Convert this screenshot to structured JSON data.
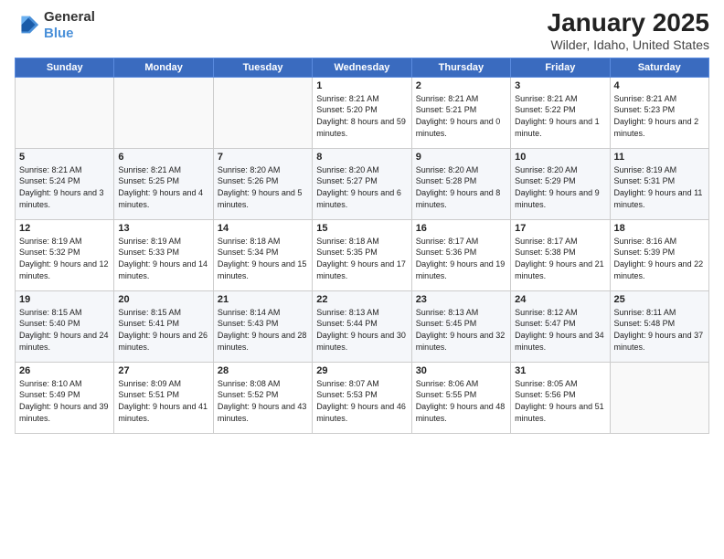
{
  "logo": {
    "general": "General",
    "blue": "Blue"
  },
  "title": "January 2025",
  "location": "Wilder, Idaho, United States",
  "weekdays": [
    "Sunday",
    "Monday",
    "Tuesday",
    "Wednesday",
    "Thursday",
    "Friday",
    "Saturday"
  ],
  "weeks": [
    [
      {
        "day": "",
        "sunrise": "",
        "sunset": "",
        "daylight": ""
      },
      {
        "day": "",
        "sunrise": "",
        "sunset": "",
        "daylight": ""
      },
      {
        "day": "",
        "sunrise": "",
        "sunset": "",
        "daylight": ""
      },
      {
        "day": "1",
        "sunrise": "Sunrise: 8:21 AM",
        "sunset": "Sunset: 5:20 PM",
        "daylight": "Daylight: 8 hours and 59 minutes."
      },
      {
        "day": "2",
        "sunrise": "Sunrise: 8:21 AM",
        "sunset": "Sunset: 5:21 PM",
        "daylight": "Daylight: 9 hours and 0 minutes."
      },
      {
        "day": "3",
        "sunrise": "Sunrise: 8:21 AM",
        "sunset": "Sunset: 5:22 PM",
        "daylight": "Daylight: 9 hours and 1 minute."
      },
      {
        "day": "4",
        "sunrise": "Sunrise: 8:21 AM",
        "sunset": "Sunset: 5:23 PM",
        "daylight": "Daylight: 9 hours and 2 minutes."
      }
    ],
    [
      {
        "day": "5",
        "sunrise": "Sunrise: 8:21 AM",
        "sunset": "Sunset: 5:24 PM",
        "daylight": "Daylight: 9 hours and 3 minutes."
      },
      {
        "day": "6",
        "sunrise": "Sunrise: 8:21 AM",
        "sunset": "Sunset: 5:25 PM",
        "daylight": "Daylight: 9 hours and 4 minutes."
      },
      {
        "day": "7",
        "sunrise": "Sunrise: 8:20 AM",
        "sunset": "Sunset: 5:26 PM",
        "daylight": "Daylight: 9 hours and 5 minutes."
      },
      {
        "day": "8",
        "sunrise": "Sunrise: 8:20 AM",
        "sunset": "Sunset: 5:27 PM",
        "daylight": "Daylight: 9 hours and 6 minutes."
      },
      {
        "day": "9",
        "sunrise": "Sunrise: 8:20 AM",
        "sunset": "Sunset: 5:28 PM",
        "daylight": "Daylight: 9 hours and 8 minutes."
      },
      {
        "day": "10",
        "sunrise": "Sunrise: 8:20 AM",
        "sunset": "Sunset: 5:29 PM",
        "daylight": "Daylight: 9 hours and 9 minutes."
      },
      {
        "day": "11",
        "sunrise": "Sunrise: 8:19 AM",
        "sunset": "Sunset: 5:31 PM",
        "daylight": "Daylight: 9 hours and 11 minutes."
      }
    ],
    [
      {
        "day": "12",
        "sunrise": "Sunrise: 8:19 AM",
        "sunset": "Sunset: 5:32 PM",
        "daylight": "Daylight: 9 hours and 12 minutes."
      },
      {
        "day": "13",
        "sunrise": "Sunrise: 8:19 AM",
        "sunset": "Sunset: 5:33 PM",
        "daylight": "Daylight: 9 hours and 14 minutes."
      },
      {
        "day": "14",
        "sunrise": "Sunrise: 8:18 AM",
        "sunset": "Sunset: 5:34 PM",
        "daylight": "Daylight: 9 hours and 15 minutes."
      },
      {
        "day": "15",
        "sunrise": "Sunrise: 8:18 AM",
        "sunset": "Sunset: 5:35 PM",
        "daylight": "Daylight: 9 hours and 17 minutes."
      },
      {
        "day": "16",
        "sunrise": "Sunrise: 8:17 AM",
        "sunset": "Sunset: 5:36 PM",
        "daylight": "Daylight: 9 hours and 19 minutes."
      },
      {
        "day": "17",
        "sunrise": "Sunrise: 8:17 AM",
        "sunset": "Sunset: 5:38 PM",
        "daylight": "Daylight: 9 hours and 21 minutes."
      },
      {
        "day": "18",
        "sunrise": "Sunrise: 8:16 AM",
        "sunset": "Sunset: 5:39 PM",
        "daylight": "Daylight: 9 hours and 22 minutes."
      }
    ],
    [
      {
        "day": "19",
        "sunrise": "Sunrise: 8:15 AM",
        "sunset": "Sunset: 5:40 PM",
        "daylight": "Daylight: 9 hours and 24 minutes."
      },
      {
        "day": "20",
        "sunrise": "Sunrise: 8:15 AM",
        "sunset": "Sunset: 5:41 PM",
        "daylight": "Daylight: 9 hours and 26 minutes."
      },
      {
        "day": "21",
        "sunrise": "Sunrise: 8:14 AM",
        "sunset": "Sunset: 5:43 PM",
        "daylight": "Daylight: 9 hours and 28 minutes."
      },
      {
        "day": "22",
        "sunrise": "Sunrise: 8:13 AM",
        "sunset": "Sunset: 5:44 PM",
        "daylight": "Daylight: 9 hours and 30 minutes."
      },
      {
        "day": "23",
        "sunrise": "Sunrise: 8:13 AM",
        "sunset": "Sunset: 5:45 PM",
        "daylight": "Daylight: 9 hours and 32 minutes."
      },
      {
        "day": "24",
        "sunrise": "Sunrise: 8:12 AM",
        "sunset": "Sunset: 5:47 PM",
        "daylight": "Daylight: 9 hours and 34 minutes."
      },
      {
        "day": "25",
        "sunrise": "Sunrise: 8:11 AM",
        "sunset": "Sunset: 5:48 PM",
        "daylight": "Daylight: 9 hours and 37 minutes."
      }
    ],
    [
      {
        "day": "26",
        "sunrise": "Sunrise: 8:10 AM",
        "sunset": "Sunset: 5:49 PM",
        "daylight": "Daylight: 9 hours and 39 minutes."
      },
      {
        "day": "27",
        "sunrise": "Sunrise: 8:09 AM",
        "sunset": "Sunset: 5:51 PM",
        "daylight": "Daylight: 9 hours and 41 minutes."
      },
      {
        "day": "28",
        "sunrise": "Sunrise: 8:08 AM",
        "sunset": "Sunset: 5:52 PM",
        "daylight": "Daylight: 9 hours and 43 minutes."
      },
      {
        "day": "29",
        "sunrise": "Sunrise: 8:07 AM",
        "sunset": "Sunset: 5:53 PM",
        "daylight": "Daylight: 9 hours and 46 minutes."
      },
      {
        "day": "30",
        "sunrise": "Sunrise: 8:06 AM",
        "sunset": "Sunset: 5:55 PM",
        "daylight": "Daylight: 9 hours and 48 minutes."
      },
      {
        "day": "31",
        "sunrise": "Sunrise: 8:05 AM",
        "sunset": "Sunset: 5:56 PM",
        "daylight": "Daylight: 9 hours and 51 minutes."
      },
      {
        "day": "",
        "sunrise": "",
        "sunset": "",
        "daylight": ""
      }
    ]
  ]
}
